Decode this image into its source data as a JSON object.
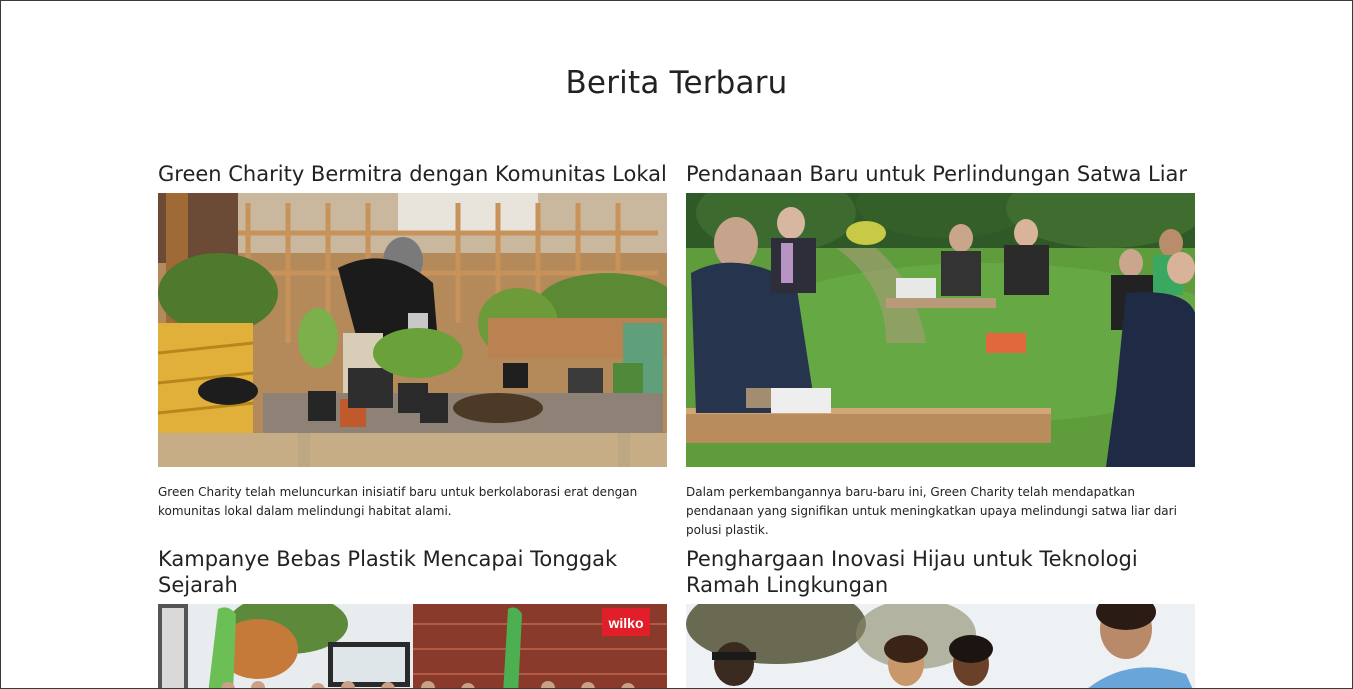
{
  "section": {
    "title": "Berita Terbaru"
  },
  "articles": [
    {
      "title": "Green Charity Bermitra dengan Komunitas Lokal",
      "excerpt": "Green Charity telah meluncurkan inisiatif baru untuk berkolaborasi erat dengan komunitas lokal dalam melindungi habitat alami.",
      "image": "gardening-volunteer-photo"
    },
    {
      "title": "Pendanaan Baru untuk Perlindungan Satwa Liar",
      "excerpt": "Dalam perkembangannya baru-baru ini, Green Charity telah mendapatkan pendanaan yang signifikan untuk meningkatkan upaya melindungi satwa liar dari polusi plastik.",
      "image": "park-community-group-photo"
    },
    {
      "title": "Kampanye Bebas Plastik Mencapai Tonggak Sejarah",
      "excerpt": "",
      "image": "campaign-crowd-photo",
      "store_sign": "wilko"
    },
    {
      "title": "Penghargaan Inovasi Hijau untuk Teknologi Ramah Lingkungan",
      "excerpt": "",
      "image": "smiling-women-group-photo"
    }
  ]
}
